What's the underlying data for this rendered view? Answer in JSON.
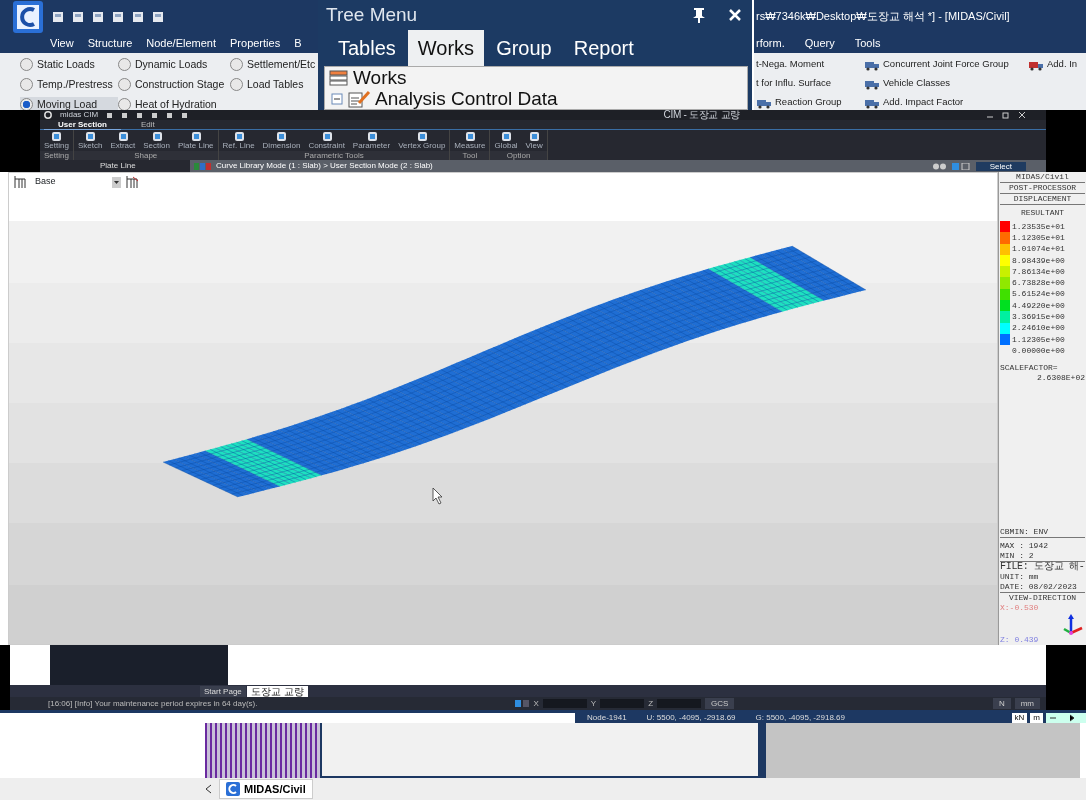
{
  "midas_window": {
    "menu": [
      "View",
      "Structure",
      "Node/Element",
      "Properties",
      "B"
    ],
    "load_options": [
      {
        "label": "Static Loads",
        "selected": false
      },
      {
        "label": "Dynamic Loads",
        "selected": false
      },
      {
        "label": "Settlement/Etc",
        "selected": false
      },
      {
        "label": "Temp./Prestress",
        "selected": false
      },
      {
        "label": "Construction Stage",
        "selected": false
      },
      {
        "label": "Load Tables",
        "selected": false
      },
      {
        "label": "Moving Load",
        "selected": true
      },
      {
        "label": "Heat of Hydration",
        "selected": false
      }
    ],
    "title": "rs₩7346k₩Desktop₩도장교 해석 *] - [MIDAS/Civil]",
    "menu_right": [
      "rform.",
      "Query",
      "Tools"
    ],
    "tools": [
      "t-Nega. Moment",
      "Concurrent Joint Force Group",
      "Add. In",
      "t for Influ. Surface",
      "Vehicle Classes",
      "Reaction Group",
      "Add. Impact Factor"
    ]
  },
  "tree_menu": {
    "title": "Tree Menu",
    "tabs": [
      {
        "label": "Tables",
        "selected": false
      },
      {
        "label": "Works",
        "selected": true
      },
      {
        "label": "Group",
        "selected": false
      },
      {
        "label": "Report",
        "selected": false
      }
    ],
    "tree": [
      {
        "label": "Works",
        "children": [
          {
            "label": "Analysis Control Data"
          }
        ]
      }
    ]
  },
  "cim_window": {
    "app_name": "midas CIM",
    "title": "CIM - 도장교 교량",
    "tabs": [
      {
        "label": "User Section",
        "selected": true
      },
      {
        "label": "Edit",
        "selected": false
      }
    ],
    "groups": [
      {
        "label": "Setting",
        "buttons": [
          "Setting"
        ]
      },
      {
        "label": "Shape",
        "buttons": [
          "Sketch",
          "Extract",
          "Section",
          "Plate Line"
        ]
      },
      {
        "label": "Parametric Tools",
        "buttons": [
          "Ref. Line",
          "Dimension",
          "Constraint",
          "Parameter",
          "Vertex Group"
        ]
      },
      {
        "label": "Tool",
        "buttons": [
          "Measure"
        ]
      },
      {
        "label": "Option",
        "buttons": [
          "Global",
          "View"
        ]
      }
    ],
    "panel_title": "Plate Line",
    "mode_path": "Curve Library Mode (1 : Slab) > User Section Mode (2 : Slab)",
    "select_label": "Select"
  },
  "viewport": {
    "layer": "Base",
    "legend": {
      "header": [
        "MIDAS/Civil",
        "POST-PROCESSOR",
        "DISPLACEMENT"
      ],
      "component": "RESULTANT",
      "levels": [
        {
          "value": "1.23535e+01",
          "color": "#ff0000"
        },
        {
          "value": "1.12305e+01",
          "color": "#ff6a00"
        },
        {
          "value": "1.01074e+01",
          "color": "#ffc000"
        },
        {
          "value": "8.98439e+00",
          "color": "#ffff00"
        },
        {
          "value": "7.86134e+00",
          "color": "#c8f000"
        },
        {
          "value": "6.73828e+00",
          "color": "#90e800"
        },
        {
          "value": "5.61524e+00",
          "color": "#40e000"
        },
        {
          "value": "4.49220e+00",
          "color": "#00e020"
        },
        {
          "value": "3.36915e+00",
          "color": "#00f0a0"
        },
        {
          "value": "2.24610e+00",
          "color": "#00ffff"
        },
        {
          "value": "1.12305e+00",
          "color": "#0070ff"
        },
        {
          "value": "0.00000e+00"
        }
      ],
      "scale_label": "SCALEFACTOR=",
      "scale_value": "2.6308E+02",
      "info": [
        "CBMIN: ENV",
        "MAX : 1942",
        "MIN : 2",
        "FILE: 도장교 해-",
        "UNIT: mm",
        "DATE: 08/02/2023"
      ],
      "view_direction": "VIEW-DIRECTION",
      "x_dir": "X:-0.530",
      "z_dir": "Z: 0.439"
    }
  },
  "bottom": {
    "doc_tabs": [
      {
        "label": "Start Page",
        "selected": false
      },
      {
        "label": "도장교 교량",
        "selected": true
      }
    ],
    "message": "[16:06] [Info] Your maintenance period expires in 64 day(s).",
    "coord_labels": [
      "X",
      "Y",
      "Z"
    ],
    "coord_system": "GCS",
    "force_unit": "N",
    "length_unit": "mm",
    "node": "Node-1941",
    "u_coords": "U: 5500, -4095, -2918.69",
    "g_coords": "G: 5500, -4095, -2918.69",
    "units": [
      "kN",
      "m"
    ],
    "task_tab": "MIDAS/Civil"
  }
}
